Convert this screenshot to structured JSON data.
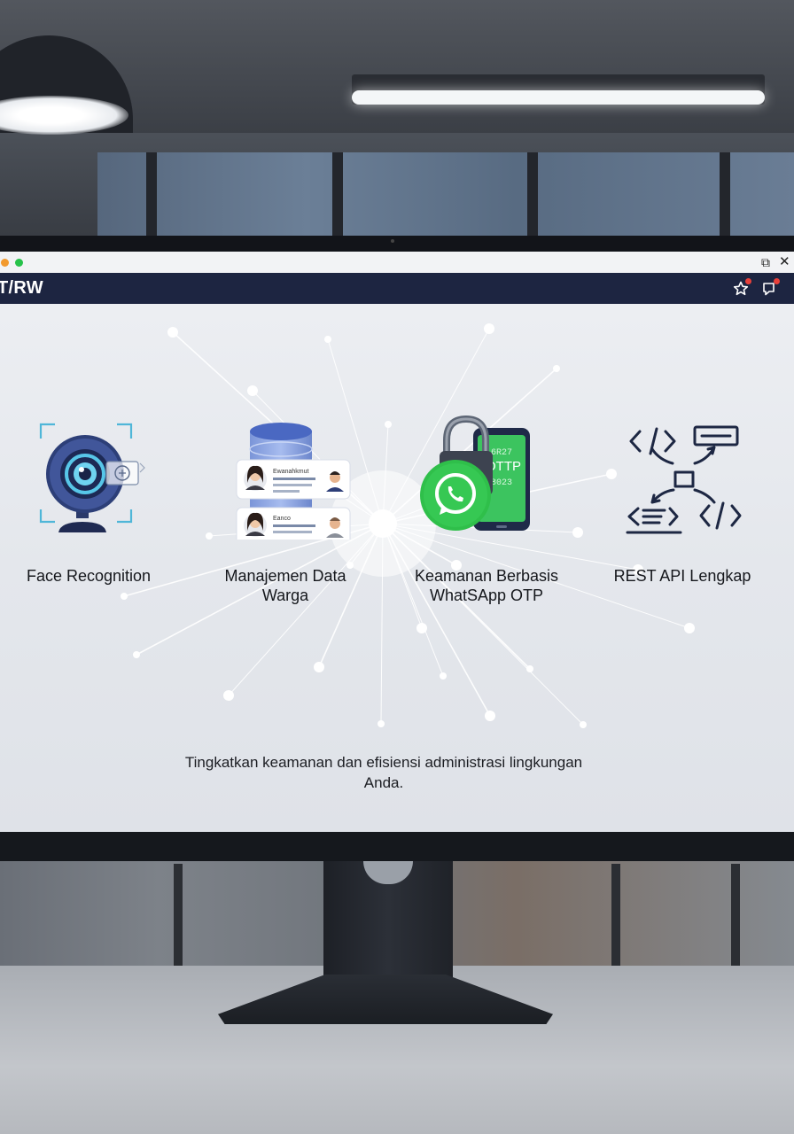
{
  "window": {
    "share_glyph": "⧉",
    "close_glyph": "✕"
  },
  "app": {
    "title": "T/RW",
    "icons": [
      "star-icon",
      "bell-icon"
    ]
  },
  "features": [
    {
      "label": "Face Recognition",
      "icon": "webcam-face-scan-icon"
    },
    {
      "label": "Manajemen Data Warga",
      "icon": "database-contacts-icon"
    },
    {
      "label": "Keamanan Berbasis WhatSApp OTP",
      "icon": "whatsapp-lock-otp-icon"
    },
    {
      "label": "REST API Lengkap",
      "icon": "api-code-icon"
    }
  ],
  "data_cards": {
    "card1_title": "Ewanahkmut",
    "card2_title": "Eanco"
  },
  "otp": {
    "line1": "6R27",
    "line2": "OTTP",
    "line3": "8023"
  },
  "tagline": "Tingkatkan keamanan dan efisiensi administrasi lingkungan Anda.",
  "colors": {
    "appbar": "#1d2541",
    "accent_whatsapp": "#2fbf4a",
    "icon_navy": "#1d2743",
    "scan_cyan": "#4fb6d8"
  }
}
